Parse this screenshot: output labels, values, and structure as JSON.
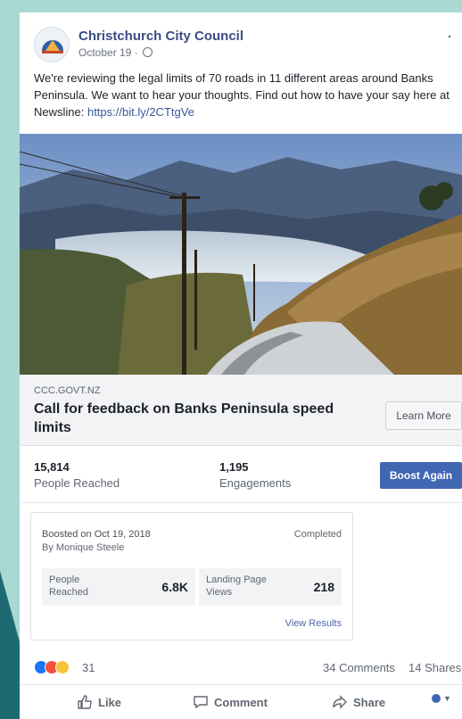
{
  "post": {
    "page_name": "Christchurch City Council",
    "date": "October 19 · ",
    "text": "We're reviewing the legal limits of 70 roads in 11 different areas around Banks Peninsula. We want to hear your thoughts. Find out how to have your say here at Newsline: ",
    "link_text": "https://bit.ly/2CTtgVe"
  },
  "link_preview": {
    "domain": "CCC.GOVT.NZ",
    "title": "Call for feedback on Banks Peninsula speed limits",
    "button": "Learn More"
  },
  "stats": {
    "reached_value": "15,814",
    "reached_label": "People Reached",
    "engagements_value": "1,195",
    "engagements_label": "Engagements",
    "boost_button": "Boost Again"
  },
  "boost": {
    "date": "Boosted on Oct 19, 2018",
    "by": "By Monique Steele",
    "status": "Completed",
    "people_label": "People Reached",
    "people_value": "6.8K",
    "landing_label": "Landing Page Views",
    "landing_value": "218",
    "view_results": "View Results"
  },
  "reactions": {
    "count": "31",
    "comments": "34 Comments",
    "shares": "14 Shares"
  },
  "actions": {
    "like": "Like",
    "comment": "Comment",
    "share": "Share"
  },
  "colors": {
    "brand": "#4267b2",
    "link": "#385898",
    "background": "#a9d9d2"
  }
}
